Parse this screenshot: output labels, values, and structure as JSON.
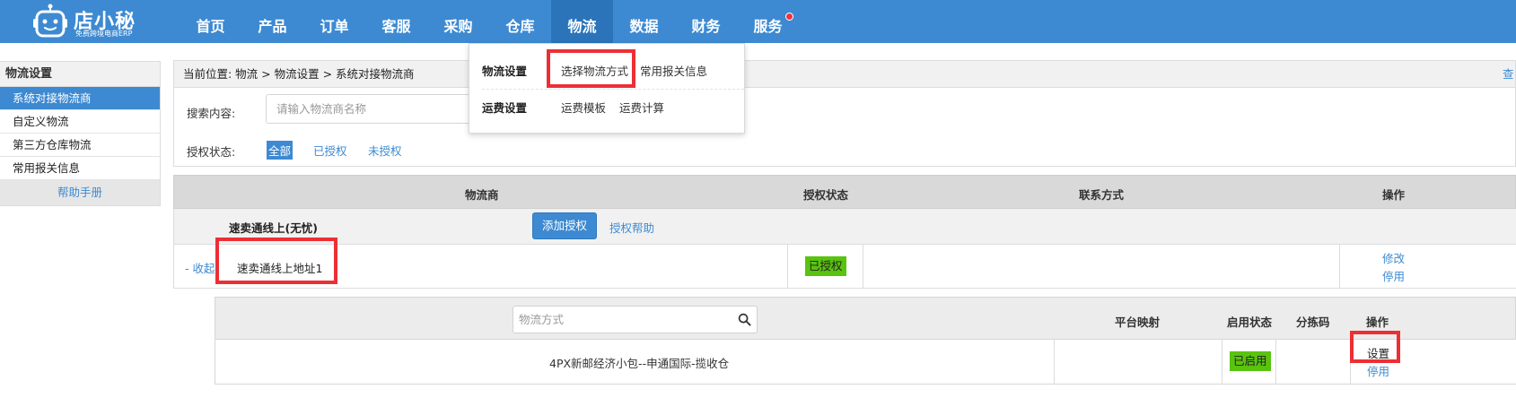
{
  "brand": {
    "name": "店小秘",
    "tagline": "免费跨境电商ERP"
  },
  "nav": {
    "items": [
      "首页",
      "产品",
      "订单",
      "客服",
      "采购",
      "仓库",
      "物流",
      "数据",
      "财务",
      "服务"
    ],
    "active": "物流"
  },
  "dropdown": {
    "row1_title": "物流设置",
    "row1_opt1": "选择物流方式",
    "row1_opt2": "常用报关信息",
    "row2_title": "运费设置",
    "row2_opt1": "运费模板",
    "row2_opt2": "运费计算"
  },
  "sidebar": {
    "head": "物流设置",
    "items": [
      "系统对接物流商",
      "自定义物流",
      "第三方仓库物流",
      "常用报关信息"
    ],
    "active_index": 0,
    "help": "帮助手册"
  },
  "breadcrumb": {
    "text": "当前位置:  物流 >  物流设置 > 系统对接物流商",
    "right": "查"
  },
  "filter": {
    "search_label": "搜索内容:",
    "search_placeholder": "请输入物流商名称",
    "auth_label": "授权状态:",
    "auth_options": [
      "全部",
      "已授权",
      "未授权"
    ],
    "auth_selected": "全部"
  },
  "table": {
    "headers": [
      "物流商",
      "授权状态",
      "联系方式",
      "操作"
    ],
    "provider_name": "速卖通线上(无忧)",
    "add_auth_button": "添加授权",
    "auth_help_link": "授权帮助",
    "collapse_link": "- 收起",
    "address": "速卖通线上地址1",
    "auth_status": "已授权",
    "op_edit": "修改",
    "op_disable": "停用"
  },
  "methods": {
    "search_placeholder": "物流方式",
    "headers": [
      "平台映射",
      "启用状态",
      "分拣码",
      "操作"
    ],
    "rows": [
      {
        "name": "4PX新邮经济小包--申通国际-揽收仓",
        "status": "已启用",
        "op_set": "设置",
        "op_disable": "停用"
      }
    ]
  },
  "colors": {
    "topbar": "#3d8ad2",
    "active_nav": "#2b74ba",
    "green_badge": "#59c30f",
    "highlight": "#ec2f35"
  }
}
